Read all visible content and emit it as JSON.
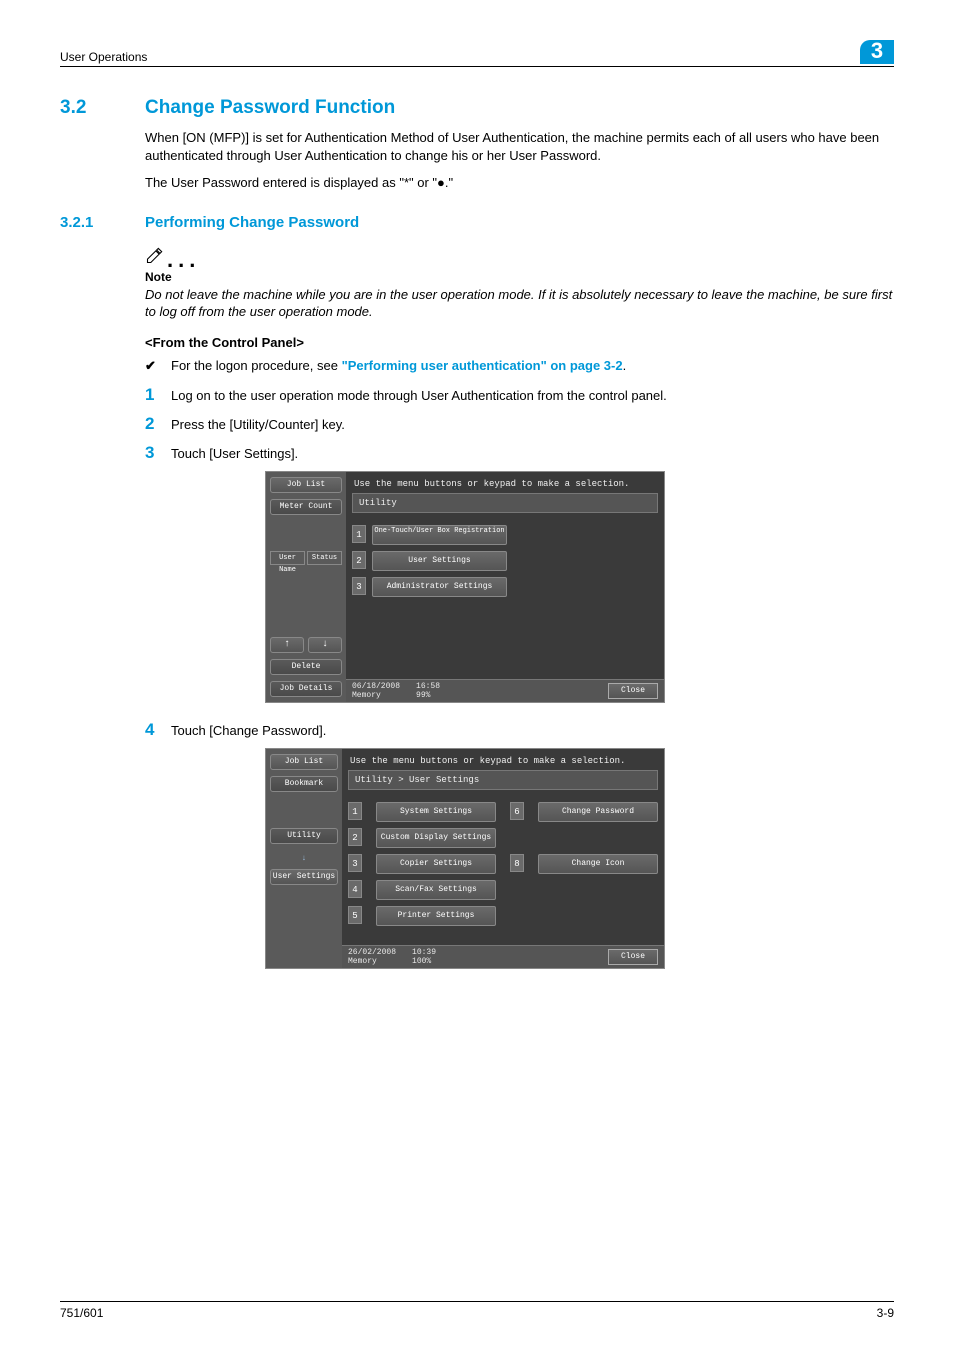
{
  "header": {
    "title": "User Operations",
    "chapter": "3"
  },
  "section": {
    "num": "3.2",
    "title": "Change Password Function"
  },
  "p1": "When [ON (MFP)] is set for Authentication Method of User Authentication, the machine permits each of all users who have been authenticated through User Authentication to change his or her User Password.",
  "p2": "The User Password entered is displayed as \"*\" or \"●.\"",
  "subsection": {
    "num": "3.2.1",
    "title": "Performing Change Password"
  },
  "note": {
    "label": "Note",
    "body": "Do not leave the machine while you are in the user operation mode. If it is absolutely necessary to leave the machine, be sure first to log off from the user operation mode."
  },
  "from_cp": "<From the Control Panel>",
  "check": {
    "pre": "For the logon procedure, see ",
    "link": "\"Performing user authentication\" on page 3-2",
    "post": "."
  },
  "steps": {
    "s1": "Log on to the user operation mode through User Authentication from the control panel.",
    "s2": "Press the [Utility/Counter] key.",
    "s3": "Touch [User Settings].",
    "s4": "Touch [Change Password]."
  },
  "screen_common": {
    "instruction": "Use the menu buttons or keypad to make a selection.",
    "close": "Close",
    "memory_label": "Memory"
  },
  "screen1": {
    "side": {
      "job_list": "Job List",
      "meter_count": "Meter Count",
      "user_name": "User Name",
      "status": "Status",
      "delete": "Delete",
      "job_details": "Job Details"
    },
    "title": "Utility",
    "menu": {
      "i1": "One-Touch/User Box Registration",
      "i2": "User Settings",
      "i3": "Administrator Settings"
    },
    "date": "06/18/2008",
    "time": "16:58",
    "memory": "99%"
  },
  "screen2": {
    "side": {
      "job_list": "Job List",
      "bookmark": "Bookmark",
      "utility": "Utility",
      "user_settings": "User Settings"
    },
    "title": "Utility > User Settings",
    "menu": {
      "i1": "System Settings",
      "i2": "Custom Display Settings",
      "i3": "Copier Settings",
      "i4": "Scan/Fax Settings",
      "i5": "Printer Settings",
      "i6": "Change Password",
      "i8": "Change Icon"
    },
    "date": "26/02/2008",
    "time": "10:39",
    "memory": "100%"
  },
  "footer": {
    "left": "751/601",
    "right": "3-9"
  }
}
